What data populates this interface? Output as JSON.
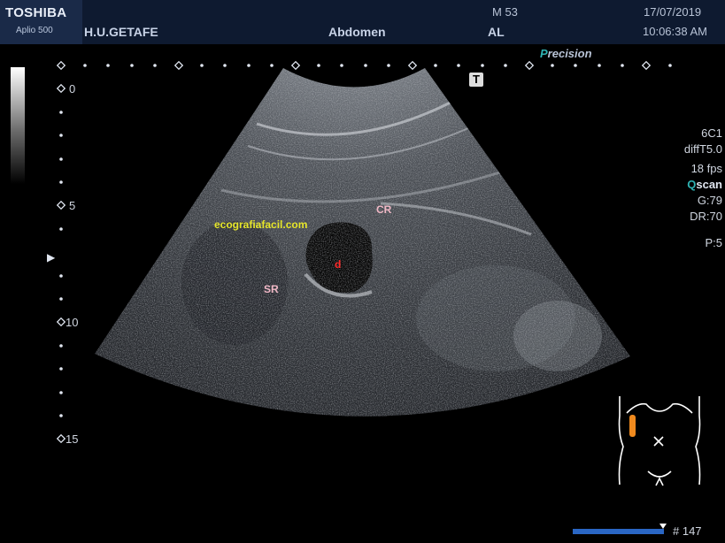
{
  "header": {
    "brand": "TOSHIBA",
    "model": "Aplio 500",
    "hospital": "H.U.GETAFE",
    "exam": "Abdomen",
    "patient_id": "M 53",
    "patient_name": "AL",
    "date": "17/07/2019",
    "time": "10:06:38 AM"
  },
  "precision": {
    "first": "P",
    "rest": "recision"
  },
  "params": {
    "probe": "6C1",
    "diff": "diffT5.0",
    "fps": "18 fps",
    "qscan_q": "Q",
    "qscan_rest": "scan",
    "gain": "G:79",
    "dr": "DR:70",
    "p": "P:5"
  },
  "depth_labels": [
    "0",
    "5",
    "10",
    "15"
  ],
  "t_mark": "T",
  "watermark": "ecografiafacil.com",
  "annotations": {
    "cr": "CR",
    "d": "d",
    "sr": "SR"
  },
  "frame_number": "# 147",
  "colors": {
    "annotation_pink": "#f0b8c6",
    "annotation_red": "#ff2a2a",
    "watermark": "#e6e62a",
    "body_marker": "#f08a1e"
  }
}
